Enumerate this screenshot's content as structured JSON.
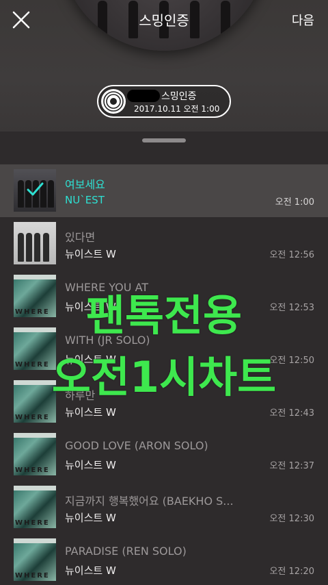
{
  "header": {
    "title": "스밍인증",
    "next_label": "다음"
  },
  "certificate": {
    "name": "스밍인증",
    "date": "2017.10.11 오전 1:00"
  },
  "songs": [
    {
      "title": "여보세요",
      "artist": "NU`EST",
      "time": "오전 1:00",
      "active": true
    },
    {
      "title": "있다면",
      "artist": "뉴이스트 W",
      "time": "오전 12:56"
    },
    {
      "title": "WHERE YOU AT",
      "artist": "뉴이스트 W",
      "time": "오전 12:53"
    },
    {
      "title": "WITH (JR SOLO)",
      "artist": "뉴이스트 W",
      "time": "오전 12:50"
    },
    {
      "title": "하루만",
      "artist": "뉴이스트 W",
      "time": "오전 12:43"
    },
    {
      "title": "GOOD LOVE (ARON SOLO)",
      "artist": "뉴이스트 W",
      "time": "오전 12:37"
    },
    {
      "title": "지금까지 행복했어요 (BAEKHO S...",
      "artist": "뉴이스트 W",
      "time": "오전 12:30"
    },
    {
      "title": "PARADISE (REN SOLO)",
      "artist": "뉴이스트 W",
      "time": "오전 12:20"
    }
  ],
  "album_art_text": "WHERE",
  "overlay": {
    "line1": "팬톡전용",
    "line2": "오전1시차트"
  },
  "icons": {
    "close": "close-icon",
    "disc": "disc-icon",
    "check": "check-icon"
  },
  "colors": {
    "accent": "#2ee0d2",
    "overlay_text": "#3ee84e"
  }
}
